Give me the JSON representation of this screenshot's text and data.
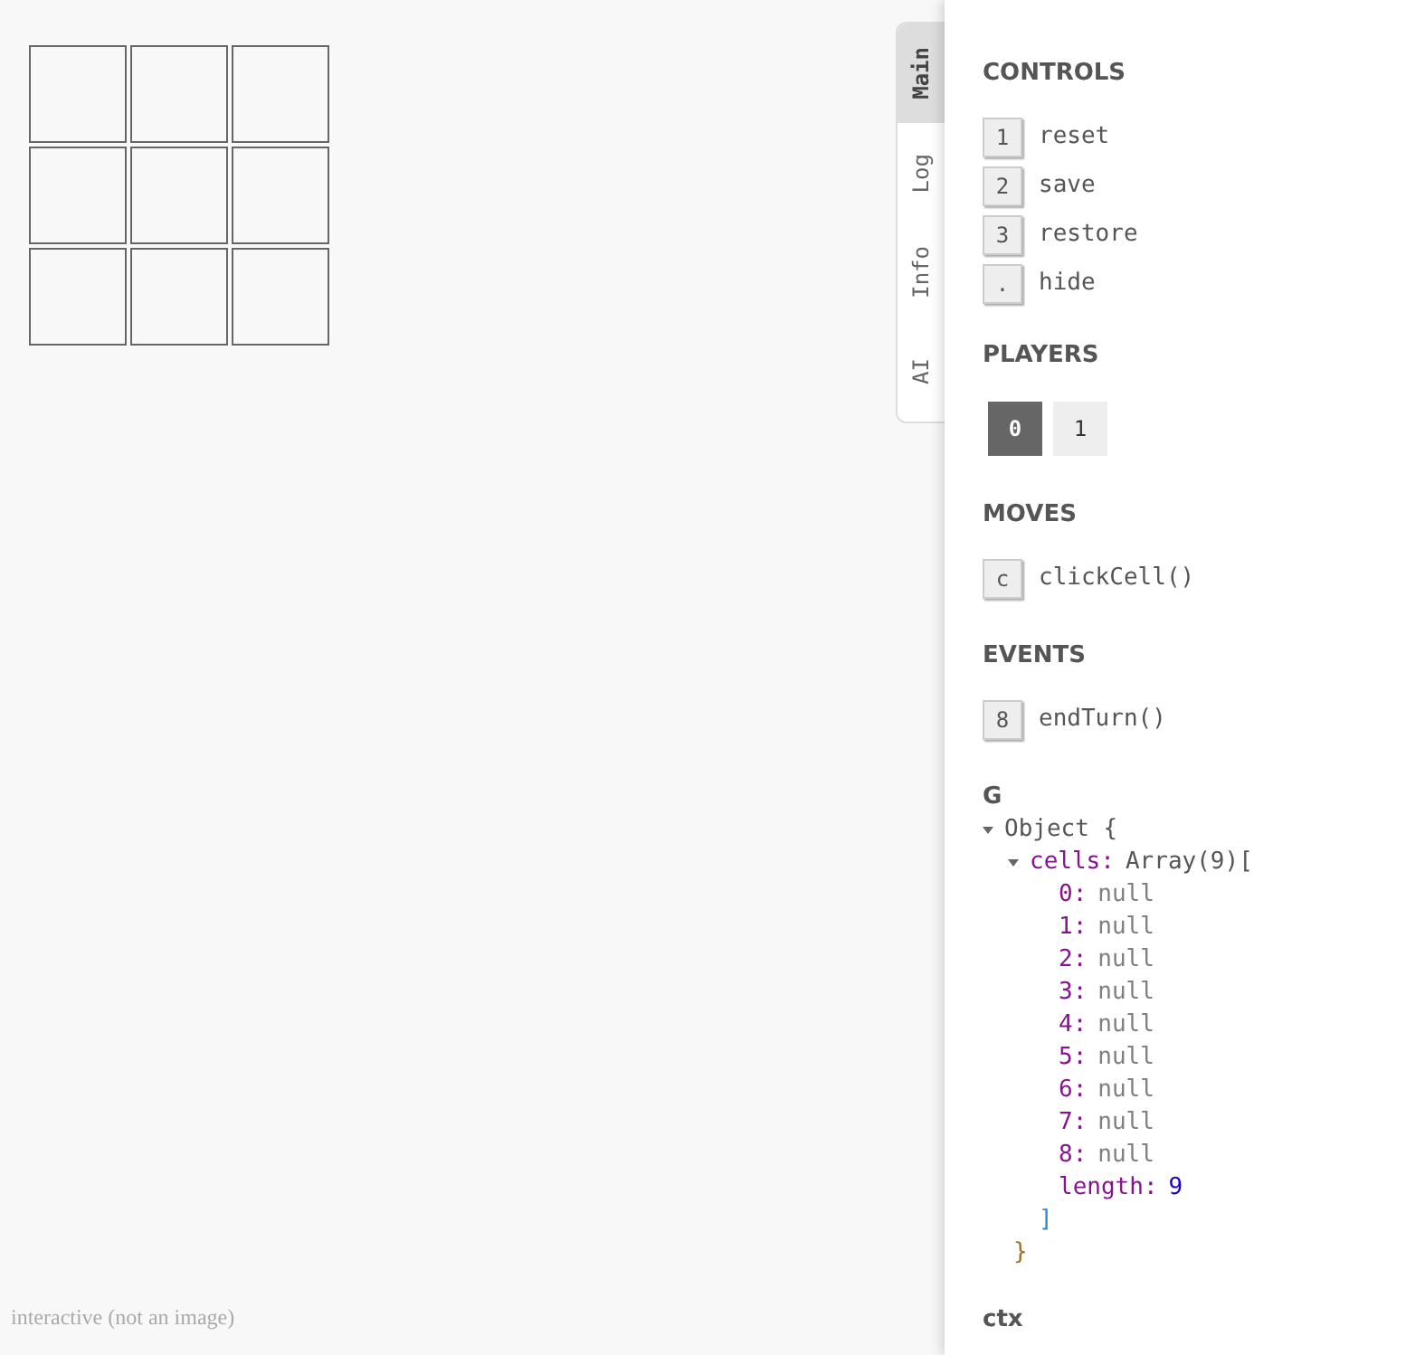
{
  "board": {
    "cells": [
      {
        "kind": "empty"
      },
      {
        "kind": "empty"
      },
      {
        "kind": "empty"
      },
      {
        "kind": "empty"
      },
      {
        "kind": "empty"
      },
      {
        "kind": "empty"
      },
      {
        "kind": "empty"
      },
      {
        "kind": "empty"
      },
      {
        "kind": "empty"
      }
    ]
  },
  "caption": "interactive (not an image)",
  "tabs": [
    {
      "label": "Main",
      "selected": true
    },
    {
      "label": "Log",
      "selected": false
    },
    {
      "label": "Info",
      "selected": false
    },
    {
      "label": "AI",
      "selected": false
    }
  ],
  "controls": {
    "title": "CONTROLS",
    "items": [
      {
        "key": "1",
        "label": "reset"
      },
      {
        "key": "2",
        "label": "save"
      },
      {
        "key": "3",
        "label": "restore"
      },
      {
        "key": ".",
        "label": "hide"
      }
    ]
  },
  "players": {
    "title": "PLAYERS",
    "items": [
      {
        "label": "0",
        "selected": true
      },
      {
        "label": "1",
        "selected": false
      }
    ]
  },
  "moves": {
    "title": "MOVES",
    "items": [
      {
        "key": "c",
        "label": "clickCell()"
      }
    ]
  },
  "events": {
    "title": "EVENTS",
    "items": [
      {
        "key": "8",
        "label": "endTurn()"
      }
    ]
  },
  "state": {
    "title": "G",
    "root": {
      "label": "Object {",
      "expanded": true,
      "close": "}",
      "children": [
        {
          "key": "cells:",
          "label": "Array(9)[",
          "expanded": true,
          "close": "]",
          "children": [
            {
              "key": "0:",
              "value": "null",
              "kind": "null"
            },
            {
              "key": "1:",
              "value": "null",
              "kind": "null"
            },
            {
              "key": "2:",
              "value": "null",
              "kind": "null"
            },
            {
              "key": "3:",
              "value": "null",
              "kind": "null"
            },
            {
              "key": "4:",
              "value": "null",
              "kind": "null"
            },
            {
              "key": "5:",
              "value": "null",
              "kind": "null"
            },
            {
              "key": "6:",
              "value": "null",
              "kind": "null"
            },
            {
              "key": "7:",
              "value": "null",
              "kind": "null"
            },
            {
              "key": "8:",
              "value": "null",
              "kind": "null"
            },
            {
              "key": "length:",
              "value": "9",
              "kind": "number"
            }
          ]
        }
      ]
    }
  },
  "ctx": {
    "title": "ctx"
  }
}
